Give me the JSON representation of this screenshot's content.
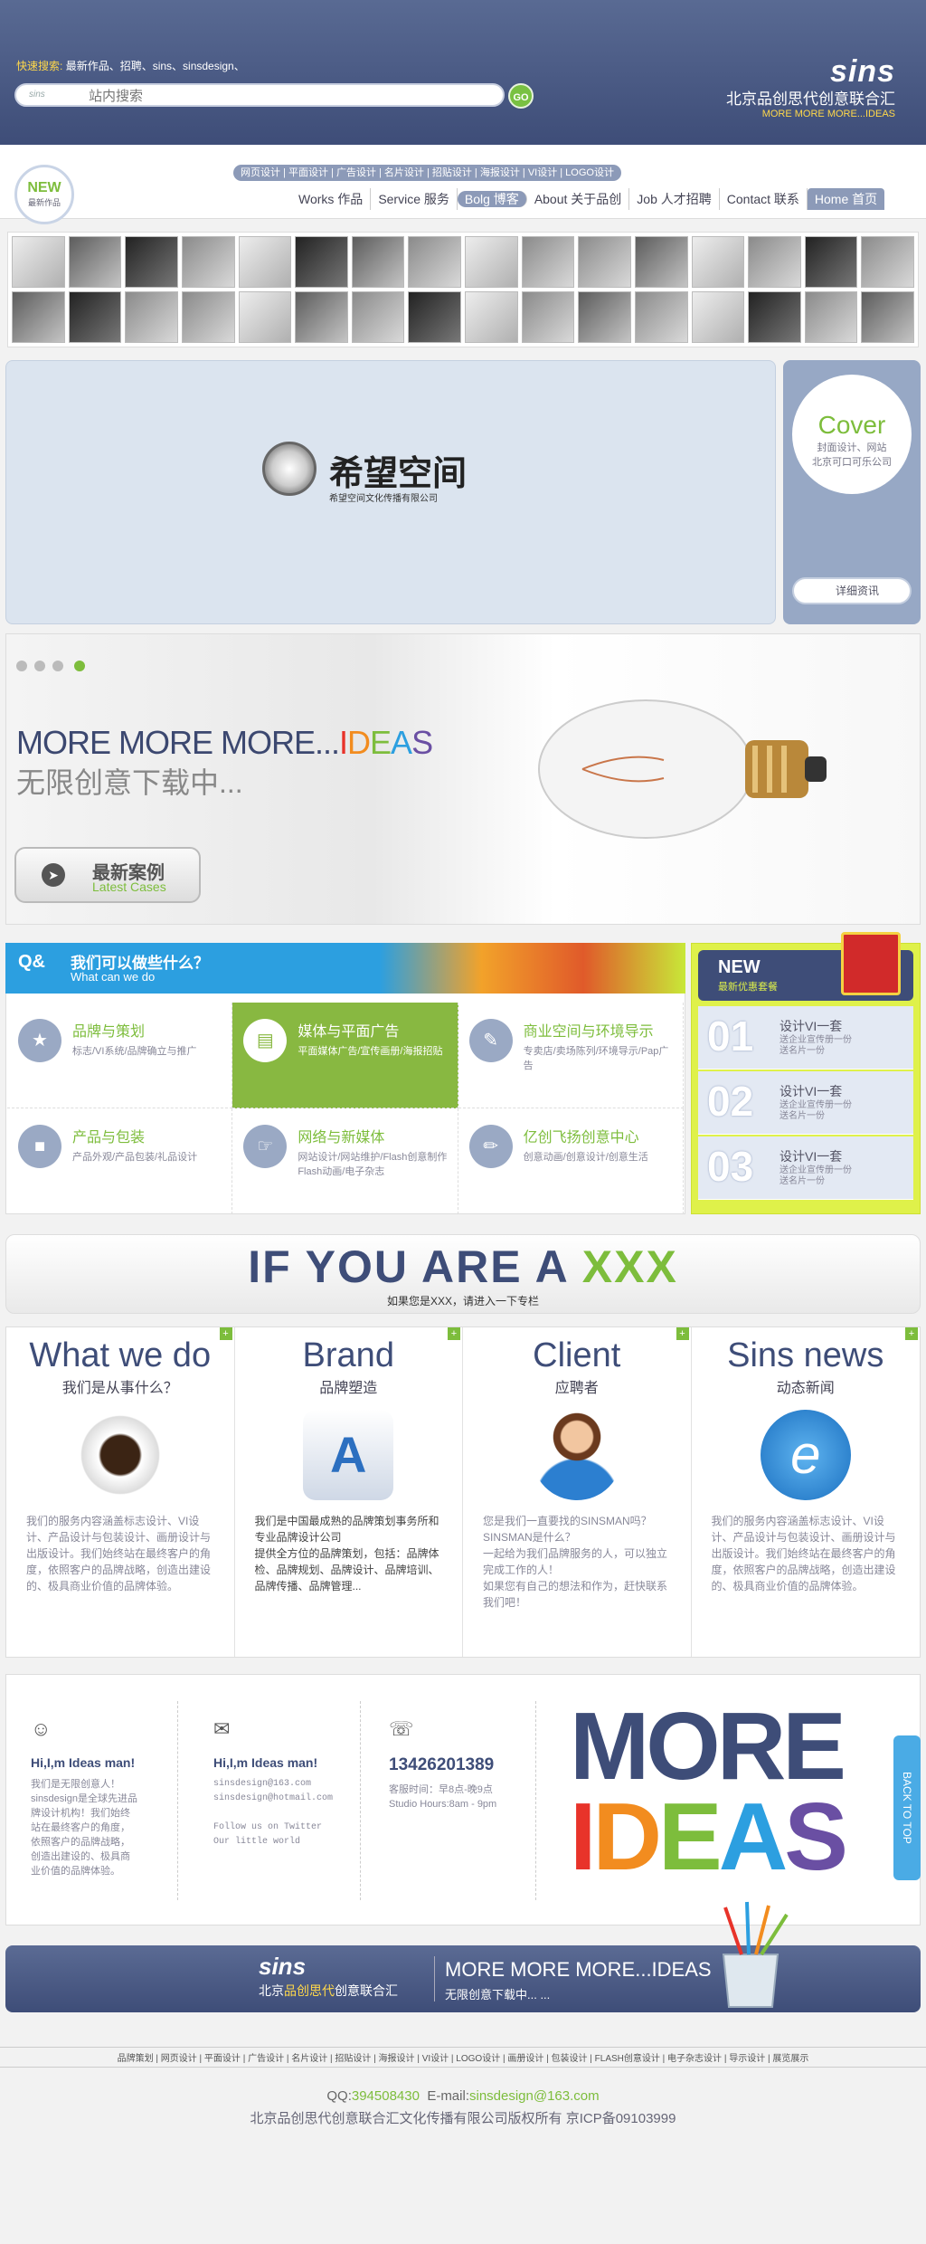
{
  "header": {
    "quick_search_label": "快速搜索:",
    "quick_search_keywords": "最新作品、招聘、sins、sinsdesign、",
    "search_placeholder": "站内搜索",
    "search_logo_text": "sins",
    "go_label": "GO",
    "brand_logo": "sins",
    "brand_cn": "北京品创思代创意联合汇",
    "brand_en": "MORE MORE MORE...IDEAS"
  },
  "nav": {
    "new_badge": "NEW",
    "new_badge_sub": "最新作品",
    "sub_items": "网页设计 | 平面设计 | 广告设计 | 名片设计 | 招贴设计 | 海报设计 | VI设计 | LOGO设计",
    "items": [
      {
        "label": "Works 作品"
      },
      {
        "label": "Service 服务"
      },
      {
        "label": "Bolg 博客"
      },
      {
        "label": "About 关于品创"
      },
      {
        "label": "Job 人才招聘"
      },
      {
        "label": "Contact 联系"
      },
      {
        "label": "Home 首页"
      }
    ]
  },
  "banner": {
    "logo_text": "希望空间",
    "logo_sub": "希望空间文化传播有限公司",
    "cover_title": "Cover",
    "cover_desc": "封面设计、网站\n北京可口可乐公司",
    "detail_button": "详细资讯"
  },
  "hero": {
    "title_prefix": "MORE MORE MORE...",
    "title_colored": [
      "I",
      "D",
      "E",
      "A",
      "S"
    ],
    "subtitle": "无限创意下载中...",
    "latest_cn": "最新案例",
    "latest_en": "Latest Cases"
  },
  "services": {
    "header_title": "我们可以做些什么？",
    "header_en": "What can we do",
    "items": [
      {
        "title": "品牌与策划",
        "desc": "标志/VI系统/品牌确立与推广"
      },
      {
        "title": "媒体与平面广告",
        "desc": "平面媒体广告/宣传画册/海报招贴"
      },
      {
        "title": "商业空间与环境导示",
        "desc": "专卖店/卖场陈列/环境导示/Pap广告"
      },
      {
        "title": "产品与包装",
        "desc": "产品外观/产品包装/礼品设计"
      },
      {
        "title": "网络与新媒体",
        "desc": "网站设计/网站维护/Flash创意制作Flash动画/电子杂志"
      },
      {
        "title": "亿创飞扬创意中心",
        "desc": "创意动画/创意设计/创意生活"
      }
    ]
  },
  "offer": {
    "head": "NEW",
    "head_sub": "最新优惠套餐",
    "items": [
      {
        "num": "01",
        "title": "设计VI一套",
        "desc": "送企业宣传册一份\n送名片一份"
      },
      {
        "num": "02",
        "title": "设计VI一套",
        "desc": "送企业宣传册一份\n送名片一份"
      },
      {
        "num": "03",
        "title": "设计VI一套",
        "desc": "送企业宣传册一份\n送名片一份"
      }
    ]
  },
  "ifyou": {
    "title_prefix": "IF YOU ARE A ",
    "title_highlight": "XXX",
    "sub": "如果您是XXX，请进入一下专栏"
  },
  "columns": [
    {
      "title": "What we do",
      "sub": "我们是从事什么？",
      "desc": "我们的服务内容涵盖标志设计、VI设计、产品设计与包装设计、画册设计与出版设计。我们始终站在最终客户的角度，依照客户的品牌战略，创造出建设的、极具商业价值的品牌体验。"
    },
    {
      "title": "Brand",
      "sub": "品牌塑造",
      "desc": "我们是中国最成熟的品牌策划事务所和专业品牌设计公司\n提供全方位的品牌策划，包括：品牌体检、品牌规划、品牌设计、品牌培训、品牌传播、品牌管理..."
    },
    {
      "title": "Client",
      "sub": "应聘者",
      "desc": "您是我们一直要找的SINSMAN吗？\nSINSMAN是什么？\n一起给为我们品牌服务的人，可以独立完成工作的人！\n如果您有自己的想法和作为，赶快联系我们吧！"
    },
    {
      "title": "Sins news",
      "sub": "动态新闻",
      "desc": "我们的服务内容涵盖标志设计、VI设计、产品设计与包装设计、画册设计与出版设计。我们始终站在最终客户的角度，依照客户的品牌战略，创造出建设的、极具商业价值的品牌体验。"
    }
  ],
  "contact": {
    "blocks": [
      {
        "heading": "Hi,I,m Ideas man!",
        "text": "我们是无限创意人！\nsinsdesign是全球先进品牌设计机构！我们始终站在最终客户的角度，依照客户的品牌战略，创造出建设的、极具商业价值的品牌体验。"
      },
      {
        "heading": "Hi,I,m Ideas man!",
        "text": "sinsdesign@163.com\nsinsdesign@hotmail.com\n\nFollow us on Twitter\nOur little world"
      },
      {
        "heading": "13426201389",
        "text": "客服时间：早8点-晚9点\nStudio Hours:8am - 9pm"
      }
    ],
    "more": "MORE",
    "ideas": [
      "I",
      "D",
      "E",
      "A",
      "S"
    ],
    "back_to_top": "BACK TO TOP"
  },
  "footer": {
    "logo": "sins",
    "cn_prefix": "北京",
    "cn_highlight": "品创思代",
    "cn_suffix": "创意联合汇",
    "right_title": "MORE MORE MORE...IDEAS",
    "right_sub": "无限创意下载中... ...",
    "links": "品牌策划 | 网页设计 | 平面设计 | 广告设计 | 名片设计 | 招贴设计 | 海报设计 | VI设计 | LOGO设计 | 画册设计 | 包装设计 | FLASH创意设计 | 电子杂志设计 | 导示设计 | 展览展示",
    "qq_label": "QQ:",
    "qq": "394508430",
    "email_label": "E-mail:",
    "email": "sinsdesign@163.com",
    "copyright": "北京品创思代创意联合汇文化传播有限公司版权所有  京ICP备09103999"
  },
  "colors": {
    "navy": "#3e4d78",
    "green": "#7dbd3c",
    "ideas": [
      "#e8332a",
      "#f28c1f",
      "#7dbd3c",
      "#2c9fe0",
      "#6a4fa3"
    ]
  }
}
